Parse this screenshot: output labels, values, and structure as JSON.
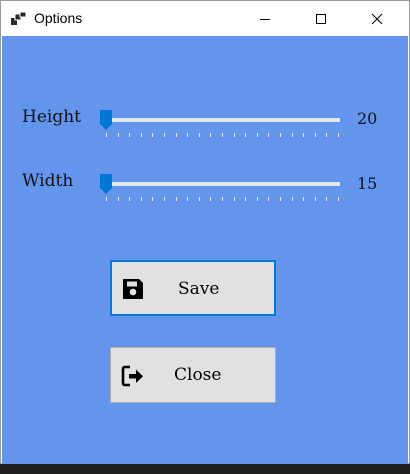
{
  "window": {
    "title": "Options",
    "icon": "app-options-icon",
    "controls": [
      "minimize-icon",
      "maximize-icon",
      "close-icon"
    ]
  },
  "settings": {
    "height": {
      "label": "Height",
      "value": "20",
      "slider_fraction": 0.0
    },
    "width": {
      "label": "Width",
      "value": "15",
      "slider_fraction": 0.0
    }
  },
  "buttons": {
    "save": {
      "label": "Save",
      "icon": "floppy-disk-icon"
    },
    "close": {
      "label": "Close",
      "icon": "sign-out-icon"
    }
  },
  "colors": {
    "client_background": "#6495ed",
    "slider_thumb": "#0078d7",
    "focus_border": "#0078d7",
    "button_face": "#e1e1e1"
  }
}
